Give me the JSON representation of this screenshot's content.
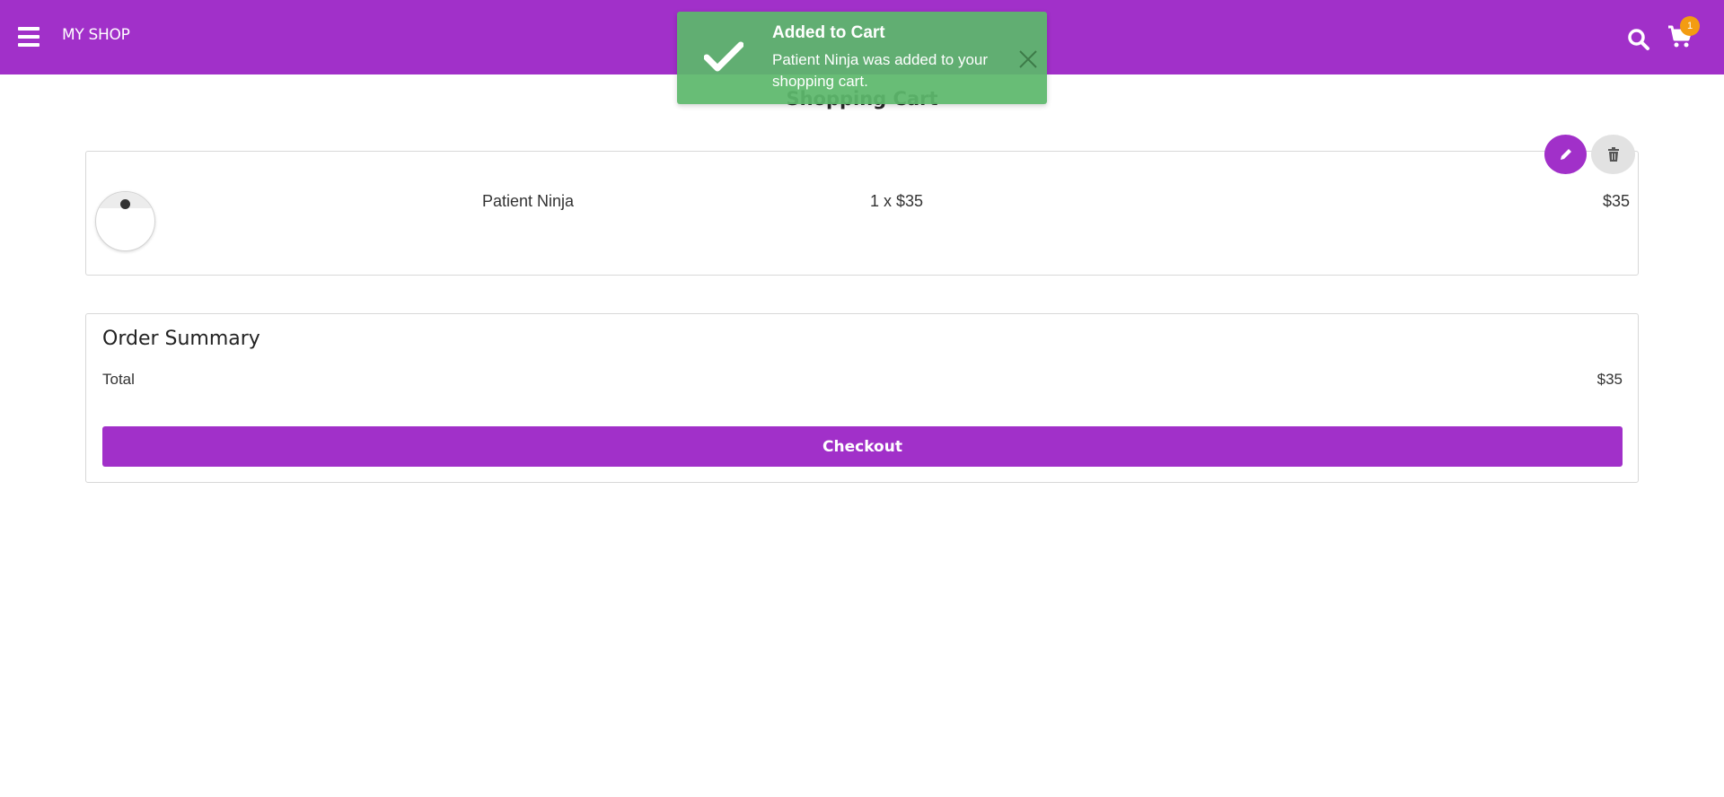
{
  "header": {
    "brand": "MY SHOP",
    "cart_count": "1",
    "accent_color": "#a130c9",
    "badge_color": "#f39c12",
    "icons": [
      "menu-icon",
      "search-icon",
      "cart-icon"
    ]
  },
  "page": {
    "title": "Shopping Cart"
  },
  "toast": {
    "title": "Added to Cart",
    "message": "Patient Ninja was added to your shopping cart.",
    "color": "#5cb86c",
    "icons": [
      "checkmark-icon",
      "close-icon"
    ]
  },
  "cart": {
    "items": [
      {
        "name": "Patient Ninja",
        "quantity_price": "1 x $35",
        "line_total": "$35"
      }
    ],
    "actions": [
      "edit-icon",
      "trash-icon"
    ]
  },
  "summary": {
    "title": "Order Summary",
    "total_label": "Total",
    "total_value": "$35",
    "checkout_label": "Checkout"
  }
}
